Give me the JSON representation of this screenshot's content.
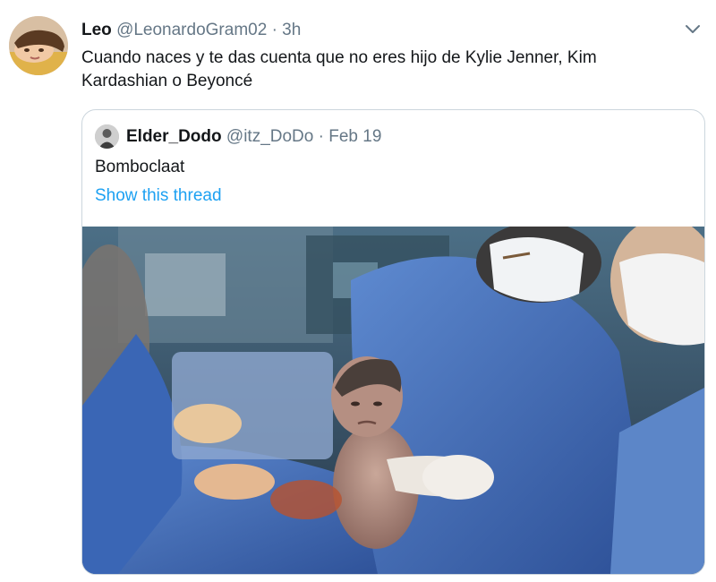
{
  "tweet": {
    "author": {
      "name": "Leo",
      "handle": "@LeonardoGram02",
      "separator": "·",
      "time": "3h"
    },
    "text": "Cuando naces y te das cuenta que no eres hijo de Kylie Jenner, Kim Kardashian o Beyoncé",
    "menu_icon": "chevron-down-icon",
    "quoted": {
      "author": {
        "name": "Elder_Dodo",
        "handle": "@itz_DoDo",
        "separator": "·",
        "time": "Feb 19"
      },
      "text": "Bomboclaat",
      "thread_link": "Show this thread",
      "media": "photo-newborn-baby-held-by-surgeons"
    }
  },
  "colors": {
    "link": "#1da1f2",
    "secondary_text": "#657786",
    "border": "#ccd6dd",
    "scrubs_blue": "#3a66b5"
  }
}
